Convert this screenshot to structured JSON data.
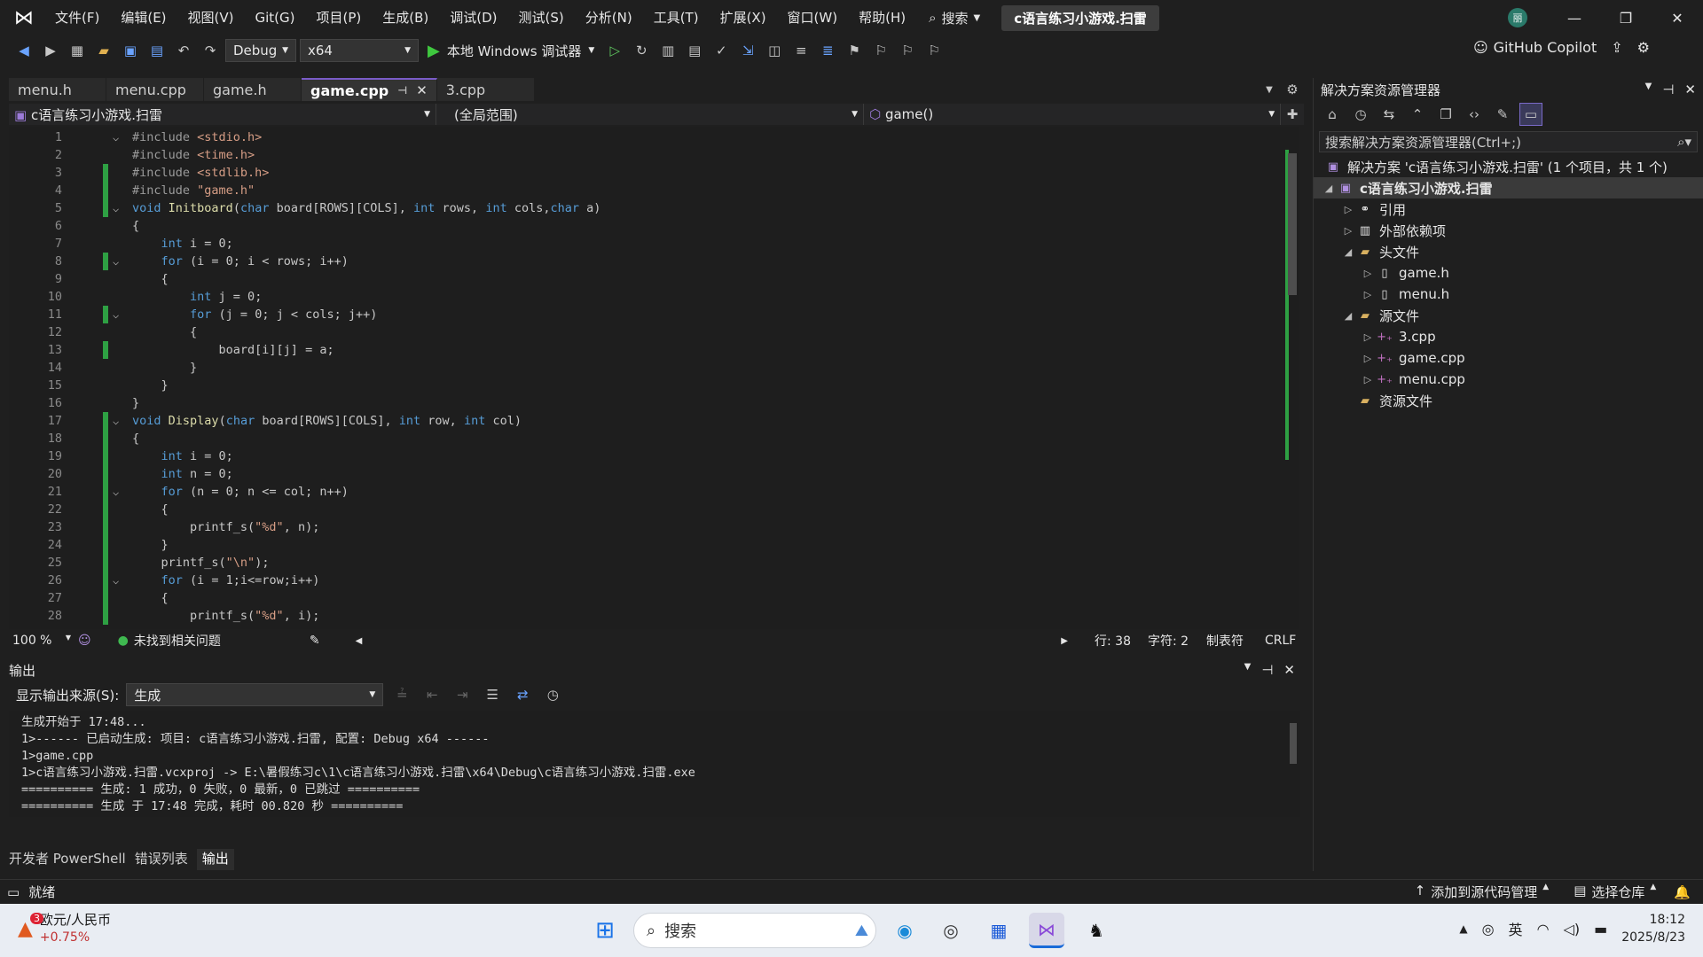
{
  "menubar": {
    "items": [
      "文件(F)",
      "编辑(E)",
      "视图(V)",
      "Git(G)",
      "项目(P)",
      "生成(B)",
      "调试(D)",
      "测试(S)",
      "分析(N)",
      "工具(T)",
      "扩展(X)",
      "窗口(W)",
      "帮助(H)"
    ],
    "search_label": "搜索",
    "solution_title": "c语言练习小游戏.扫雷",
    "avatar_initial": "丽"
  },
  "toolbar": {
    "config": "Debug",
    "platform": "x64",
    "run_label": "本地 Windows 调试器",
    "copilot_label": "GitHub Copilot"
  },
  "editor": {
    "tabs": [
      {
        "label": "menu.h"
      },
      {
        "label": "menu.cpp"
      },
      {
        "label": "game.h"
      },
      {
        "label": "game.cpp"
      },
      {
        "label": "3.cpp"
      }
    ],
    "nav_project": "c语言练习小游戏.扫雷",
    "nav_scope": "(全局范围)",
    "nav_function": "game()",
    "lines": [
      {
        "n": "1",
        "t": "#include <stdio.h>"
      },
      {
        "n": "2",
        "t": "#include <time.h>"
      },
      {
        "n": "3",
        "t": "#include <stdlib.h>"
      },
      {
        "n": "4",
        "t": "#include \"game.h\""
      },
      {
        "n": "5",
        "t": "void Initboard(char board[ROWS][COLS], int rows, int cols,char a)"
      },
      {
        "n": "6",
        "t": "{"
      },
      {
        "n": "7",
        "t": "    int i = 0;"
      },
      {
        "n": "8",
        "t": "    for (i = 0; i < rows; i++)"
      },
      {
        "n": "9",
        "t": "    {"
      },
      {
        "n": "10",
        "t": "        int j = 0;"
      },
      {
        "n": "11",
        "t": "        for (j = 0; j < cols; j++)"
      },
      {
        "n": "12",
        "t": "        {"
      },
      {
        "n": "13",
        "t": "            board[i][j] = a;"
      },
      {
        "n": "14",
        "t": "        }"
      },
      {
        "n": "15",
        "t": "    }"
      },
      {
        "n": "16",
        "t": "}"
      },
      {
        "n": "17",
        "t": "void Display(char board[ROWS][COLS], int row, int col)"
      },
      {
        "n": "18",
        "t": "{"
      },
      {
        "n": "19",
        "t": "    int i = 0;"
      },
      {
        "n": "20",
        "t": "    int n = 0;"
      },
      {
        "n": "21",
        "t": "    for (n = 0; n <= col; n++)"
      },
      {
        "n": "22",
        "t": "    {"
      },
      {
        "n": "23",
        "t": "        printf_s(\"%d\", n);"
      },
      {
        "n": "24",
        "t": "    }"
      },
      {
        "n": "25",
        "t": "    printf_s(\"\\n\");"
      },
      {
        "n": "26",
        "t": "    for (i = 1;i<=row;i++)"
      },
      {
        "n": "27",
        "t": "    {"
      },
      {
        "n": "28",
        "t": "        printf_s(\"%d\", i);"
      }
    ],
    "status": {
      "zoom": "100 %",
      "issues": "未找到相关问题",
      "line": "行: 38",
      "char": "字符: 2",
      "indent": "制表符",
      "eol": "CRLF"
    }
  },
  "solution_explorer": {
    "title": "解决方案资源管理器",
    "search_placeholder": "搜索解决方案资源管理器(Ctrl+;)",
    "nodes": [
      {
        "label": "解决方案 'c语言练习小游戏.扫雷' (1 个项目，共 1 个)"
      },
      {
        "label": "c语言练习小游戏.扫雷"
      },
      {
        "label": "引用"
      },
      {
        "label": "外部依赖项"
      },
      {
        "label": "头文件"
      },
      {
        "label": "game.h"
      },
      {
        "label": "menu.h"
      },
      {
        "label": "源文件"
      },
      {
        "label": "3.cpp"
      },
      {
        "label": "game.cpp"
      },
      {
        "label": "menu.cpp"
      },
      {
        "label": "资源文件"
      }
    ]
  },
  "output": {
    "title": "输出",
    "source_label": "显示输出来源(S):",
    "source_value": "生成",
    "lines": [
      "生成开始于 17:48...",
      "1>------ 已启动生成: 项目: c语言练习小游戏.扫雷, 配置: Debug x64 ------",
      "1>game.cpp",
      "1>c语言练习小游戏.扫雷.vcxproj -> E:\\暑假练习c\\1\\c语言练习小游戏.扫雷\\x64\\Debug\\c语言练习小游戏.扫雷.exe",
      "========== 生成: 1 成功，0 失败，0 最新，0 已跳过 ==========",
      "========== 生成 于 17:48 完成，耗时 00.820 秒 =========="
    ],
    "bottom_tabs": [
      "开发者 PowerShell",
      "错误列表",
      "输出"
    ]
  },
  "statusbar": {
    "ready": "就绪",
    "add_source_control": "添加到源代码管理",
    "select_repo": "选择仓库"
  },
  "taskbar": {
    "weather_title": "欧元/人民币",
    "weather_value": "+0.75%",
    "weather_badge": "3",
    "search_label": "搜索",
    "ime": "英",
    "time": "18:12",
    "date": "2025/8/23"
  }
}
